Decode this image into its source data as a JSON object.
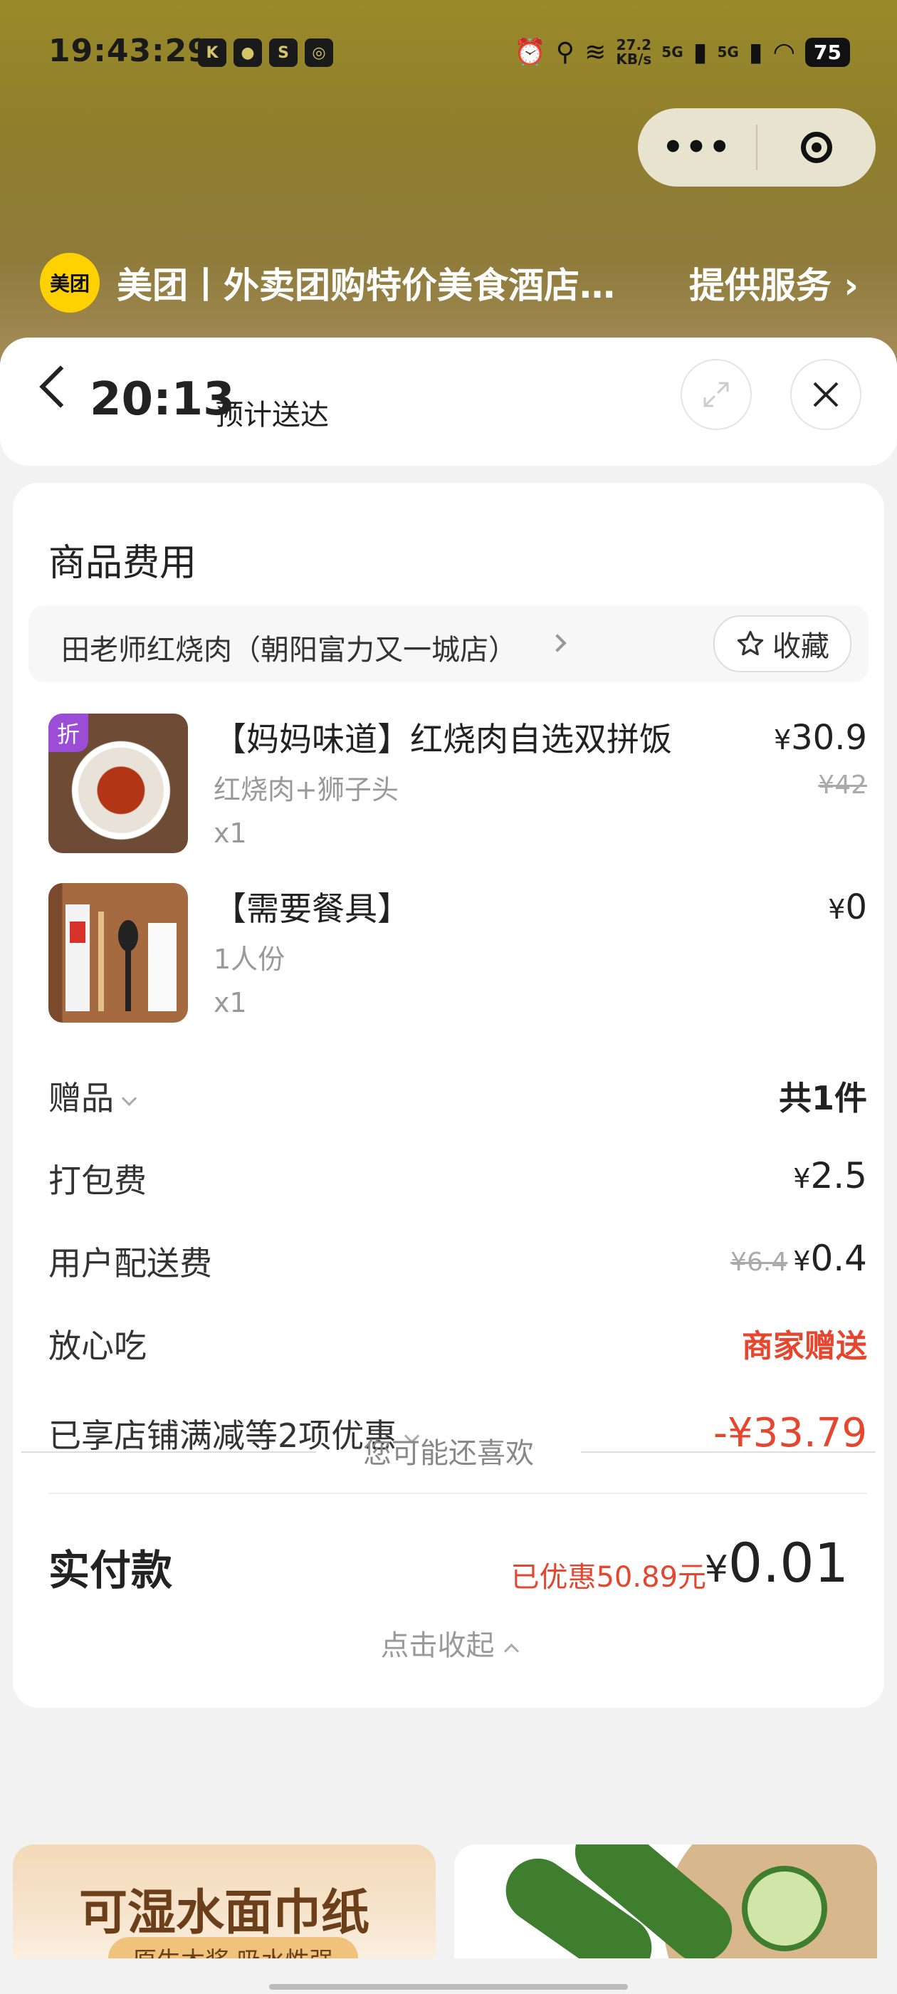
{
  "status_bar": {
    "time": "19:43:29",
    "left_apps": [
      "K",
      "WeChat",
      "Soul",
      "Weibo"
    ],
    "net_speed": "27.2",
    "net_unit": "KB/s",
    "sig1": "5G",
    "sig2": "5G",
    "battery": "75"
  },
  "capsule": {
    "more": "•••"
  },
  "miniprogram": {
    "logo": "美团",
    "name": "美团丨外卖团购特价美食酒店…",
    "provider": "提供服务 ›"
  },
  "header": {
    "eta_time": "20:13",
    "eta_label": "预计送达"
  },
  "card": {
    "title": "商品费用",
    "shop_name": "田老师红烧肉（朝阳富力又一城店）",
    "fav_label": "收藏",
    "items": [
      {
        "badge": "折",
        "name": "【妈妈味道】红烧肉自选双拼饭",
        "spec": "红烧肉+狮子头",
        "qty": "x1",
        "price": "30.9",
        "orig": "¥42"
      },
      {
        "name": "【需要餐具】",
        "spec": "1人份",
        "qty": "x1",
        "price": "0"
      }
    ],
    "fees": {
      "gift_label": "赠品",
      "gift_value": "共1件",
      "pack_label": "打包费",
      "pack_value": "2.5",
      "delivery_label": "用户配送费",
      "delivery_orig": "¥6.4",
      "delivery_value": "0.4",
      "safe_label": "放心吃",
      "safe_value": "商家赠送",
      "discount_label": "已享店铺满减等2项优惠",
      "discount_value": "-¥33.79"
    },
    "pay_label": "实付款",
    "saved": "已优惠50.89元",
    "total": "0.01",
    "collapse": "点击收起"
  },
  "currency_symbol": "¥",
  "recommend": {
    "title": "您可能还喜欢",
    "left_big": "可湿水面巾纸",
    "left_sub": "原生木浆 吸水性强"
  }
}
